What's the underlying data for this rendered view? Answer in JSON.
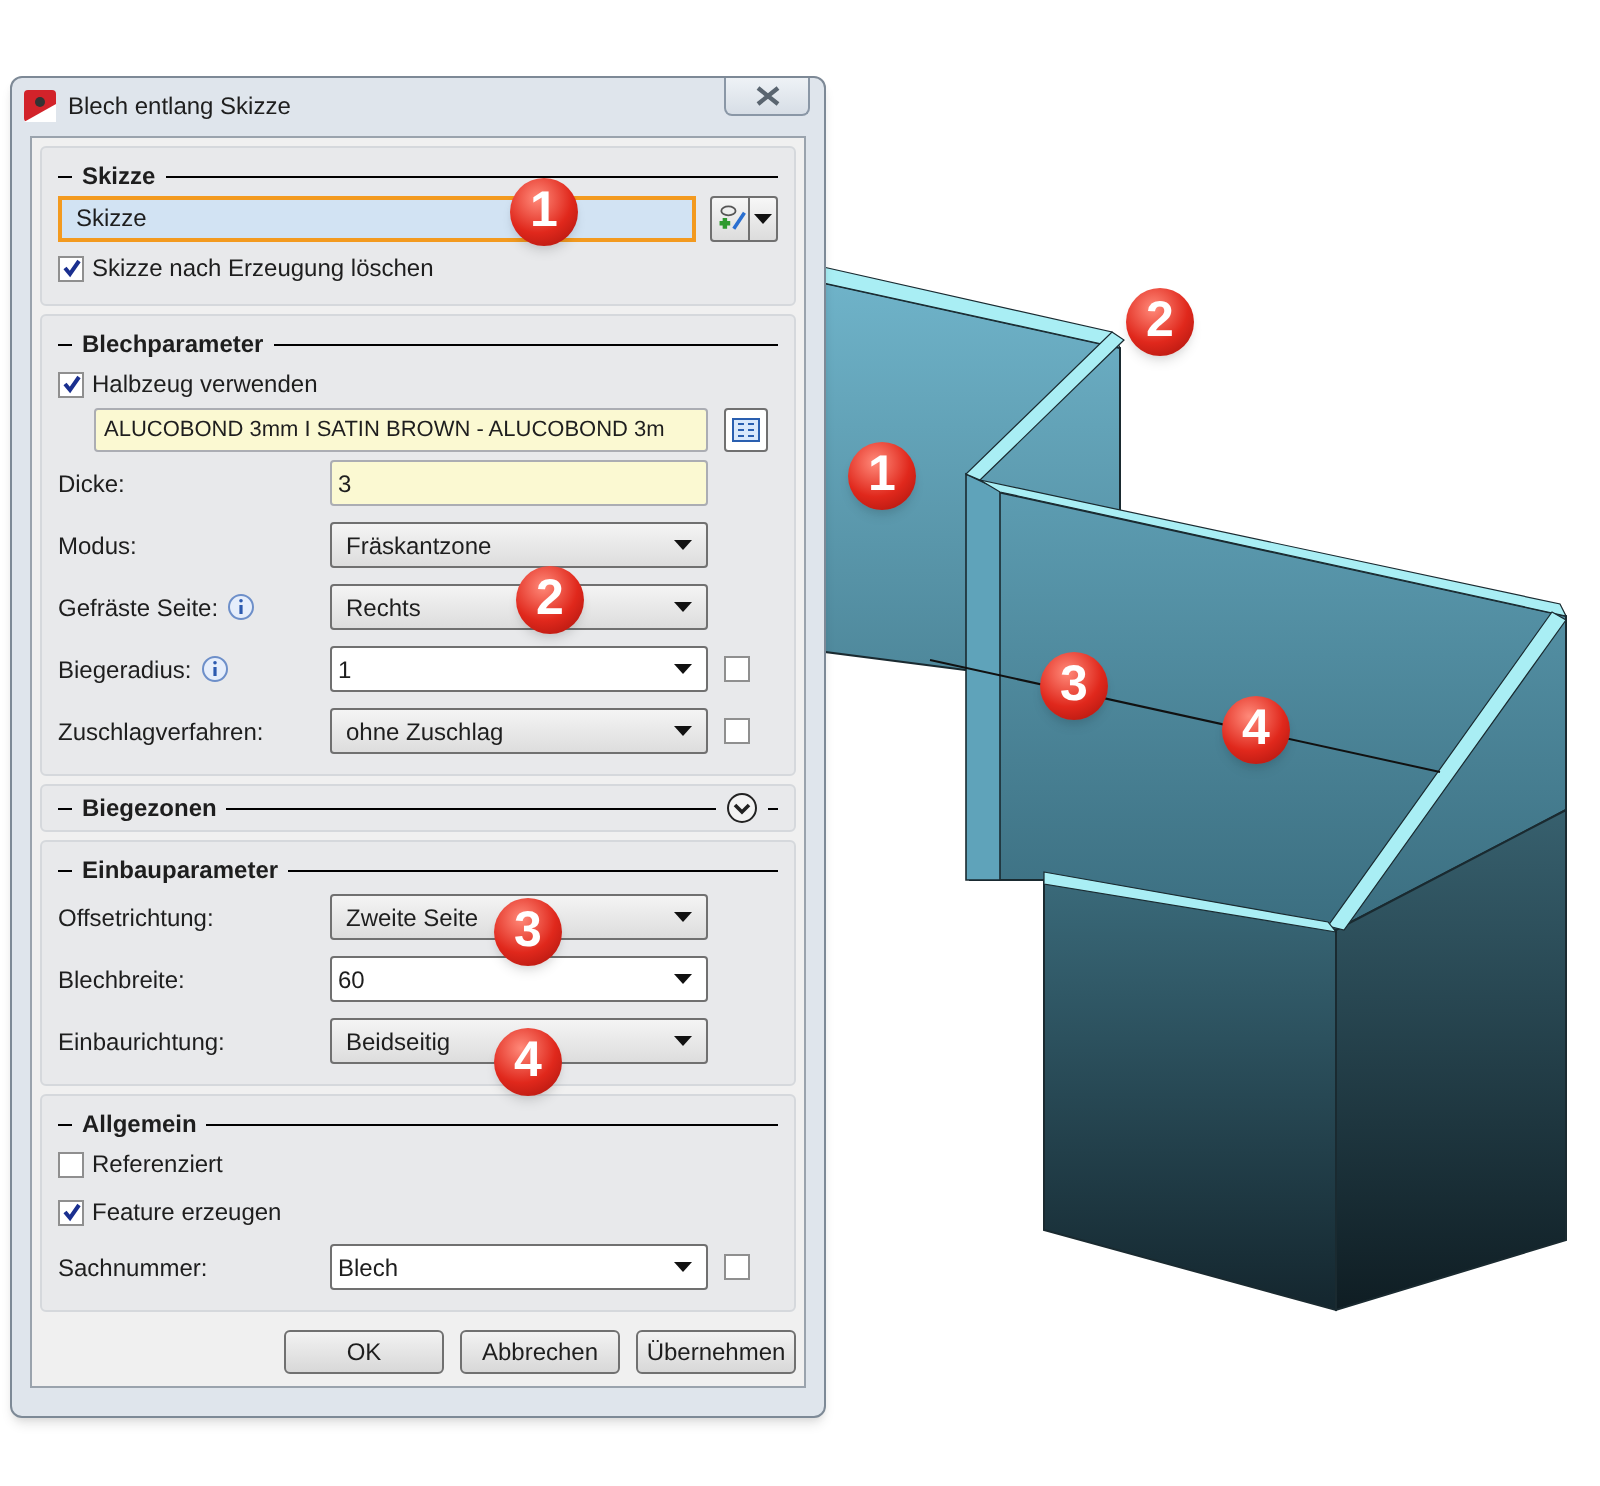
{
  "window": {
    "title": "Blech entlang Skizze"
  },
  "sections": [
    {
      "title": "Skizze",
      "expanded": true,
      "rows": [
        {
          "kind": "sketch",
          "value": "Skizze",
          "highlighted": true
        },
        {
          "kind": "checkbox",
          "label": "Skizze nach Erzeugung löschen",
          "checked": true
        }
      ]
    },
    {
      "title": "Blechparameter",
      "expanded": true,
      "rows": [
        {
          "kind": "checkbox",
          "label": "Halbzeug verwenden",
          "checked": true
        },
        {
          "kind": "material",
          "value": "ALUCOBOND 3mm I SATIN BROWN - ALUCOBOND 3m"
        },
        {
          "kind": "input",
          "label": "Dicke:",
          "value": "3"
        },
        {
          "kind": "dropdown",
          "label": "Modus:",
          "value": "Fräskantzone"
        },
        {
          "kind": "dropdown",
          "label": "Gefräste Seite:",
          "info": true,
          "value": "Rechts"
        },
        {
          "kind": "combo",
          "label": "Biegeradius:",
          "info": true,
          "value": "1",
          "side_checked": false
        },
        {
          "kind": "dropdown",
          "label": "Zuschlagverfahren:",
          "value": "ohne Zuschlag",
          "side_checked": false
        }
      ]
    },
    {
      "title": "Biegezonen",
      "expanded": false
    },
    {
      "title": "Einbauparameter",
      "expanded": true,
      "rows": [
        {
          "kind": "dropdown",
          "label": "Offsetrichtung:",
          "value": "Zweite Seite"
        },
        {
          "kind": "combo",
          "label": "Blechbreite:",
          "value": "60"
        },
        {
          "kind": "dropdown",
          "label": "Einbaurichtung:",
          "value": "Beidseitig"
        }
      ]
    },
    {
      "title": "Allgemein",
      "expanded": true,
      "rows": [
        {
          "kind": "checkbox",
          "label": "Referenziert",
          "checked": false
        },
        {
          "kind": "checkbox",
          "label": "Feature erzeugen",
          "checked": true
        },
        {
          "kind": "combo",
          "label": "Sachnummer:",
          "value": "Blech",
          "side_checked": false
        }
      ]
    }
  ],
  "buttons": [
    "OK",
    "Abbrechen",
    "Übernehmen"
  ],
  "callouts": [
    {
      "label": "1"
    },
    {
      "label": "2"
    },
    {
      "label": "3"
    },
    {
      "label": "4"
    },
    {
      "label": "1"
    },
    {
      "label": "2"
    },
    {
      "label": "3"
    },
    {
      "label": "4"
    }
  ]
}
